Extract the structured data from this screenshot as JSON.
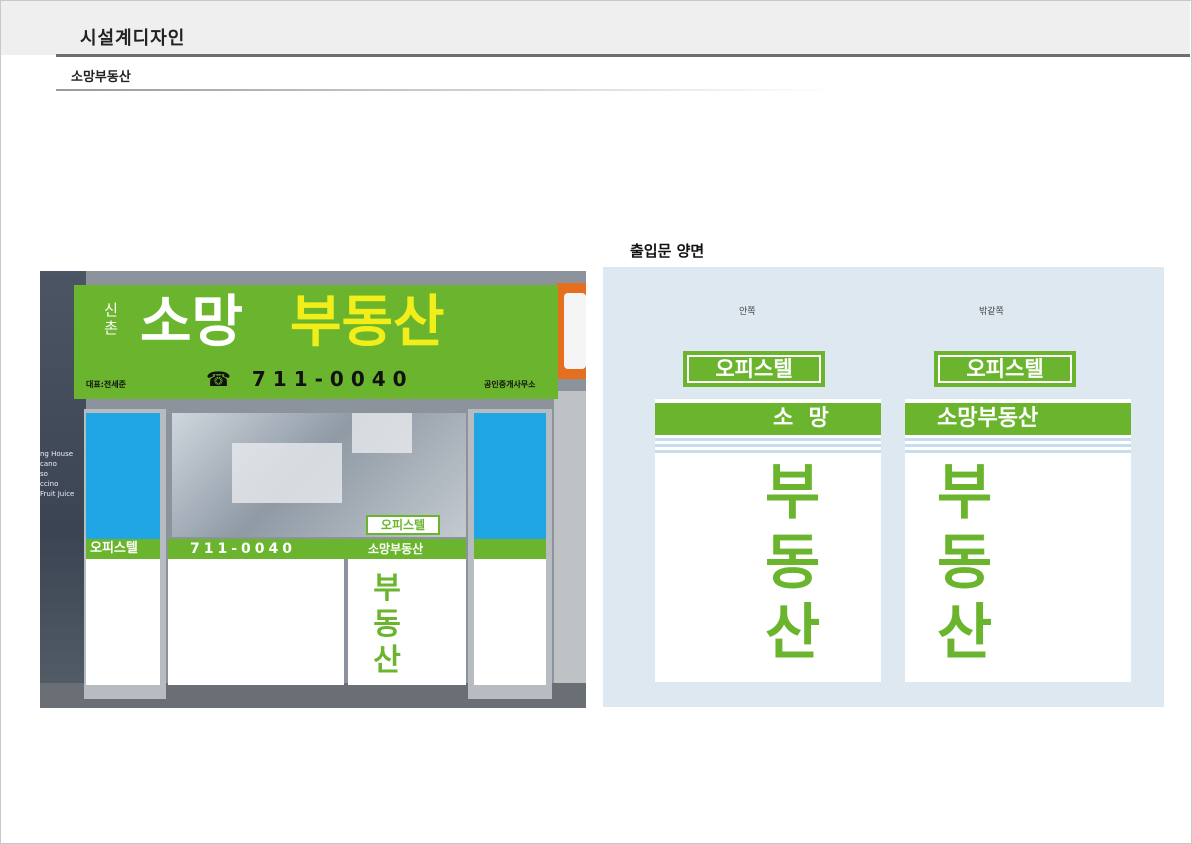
{
  "header": {
    "title": "시설계디자인",
    "subtitle": "소망부동산"
  },
  "storefront": {
    "sign": {
      "region": "신촌",
      "name_white": "소망",
      "name_yellow": "부동산",
      "phone": "☎ 711-0040",
      "representative": "대표:전세준",
      "office_type": "공인중개사무소"
    },
    "wall_text": [
      "ng House",
      "cano",
      "so",
      "ccino",
      "Fruit Juice"
    ],
    "left_strip": "오피스텔",
    "window_phone": "711-0040",
    "door_badge": "오피스텔",
    "door_strip": "소망부동산",
    "door_vertical": [
      "부",
      "동",
      "산"
    ],
    "colors": {
      "green": "#6ab52d",
      "yellow": "#f2ee1a",
      "blue": "#21a6e5"
    }
  },
  "door_design": {
    "label": "출입문 양면",
    "inside": {
      "label": "안쪽",
      "badge": "오피스텔",
      "band": "소  망",
      "vertical": [
        "부",
        "동",
        "산"
      ]
    },
    "outside": {
      "label": "밖같쪽",
      "badge": "오피스텔",
      "band": "소망부동산",
      "vertical": [
        "부",
        "동",
        "산"
      ]
    }
  }
}
